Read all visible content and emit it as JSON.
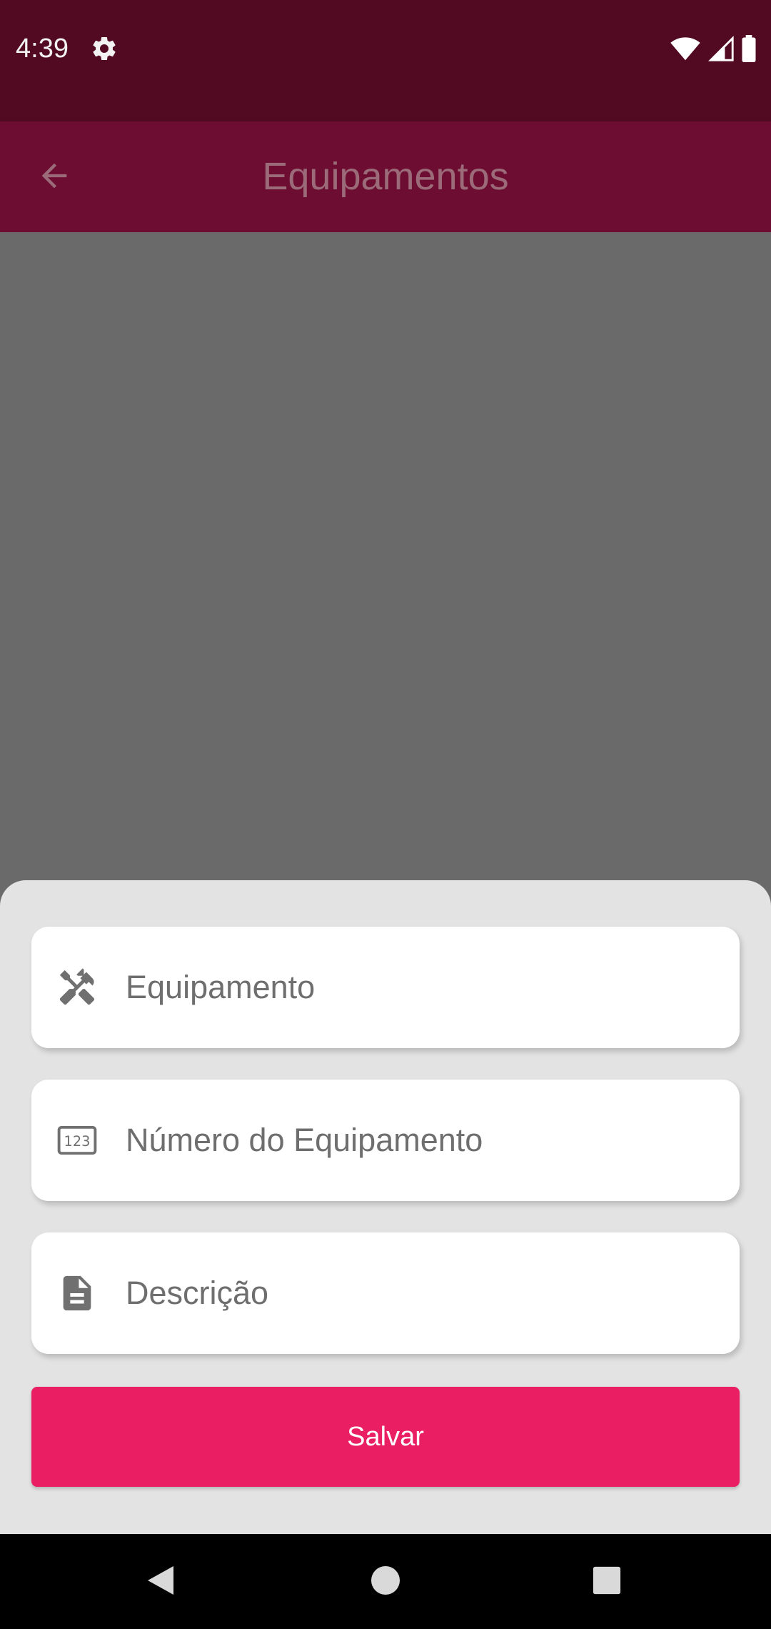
{
  "status_bar": {
    "time": "4:39",
    "icons": [
      "settings-icon",
      "wifi-icon",
      "signal-icon",
      "battery-icon"
    ]
  },
  "app_bar": {
    "title": "Equipamentos",
    "back_icon": "arrow-back-icon"
  },
  "form": {
    "fields": [
      {
        "icon": "tools-icon",
        "placeholder": "Equipamento",
        "value": ""
      },
      {
        "icon": "numbers-123-icon",
        "placeholder": "Número do Equipamento",
        "value": ""
      },
      {
        "icon": "document-icon",
        "placeholder": "Descrição",
        "value": ""
      }
    ],
    "save_label": "Salvar"
  },
  "nav_bar": {
    "icons": [
      "nav-back-icon",
      "nav-home-icon",
      "nav-recents-icon"
    ]
  },
  "colors": {
    "status_bar": "#520a22",
    "app_bar": "#6c0d31",
    "scrim": "#6a6a6a",
    "sheet": "#e3e3e3",
    "accent": "#e91e63"
  }
}
